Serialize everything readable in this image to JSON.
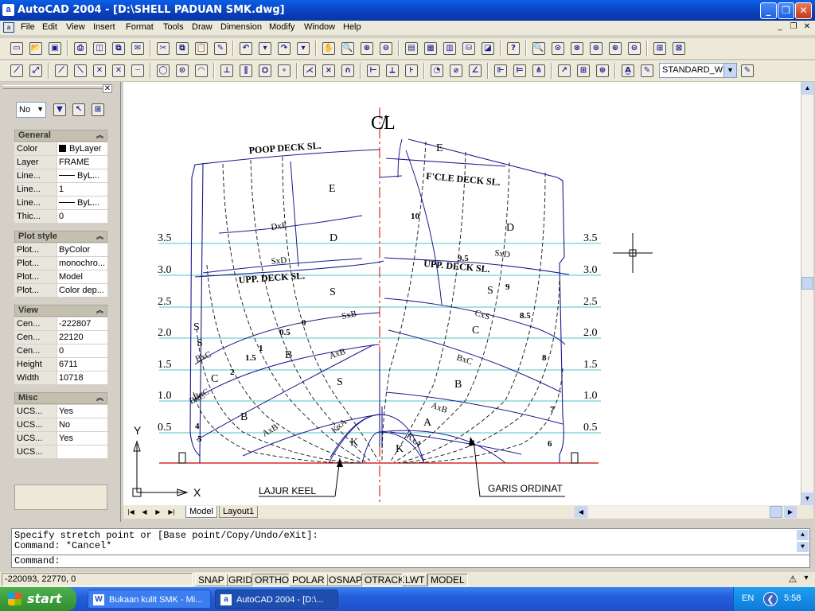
{
  "window": {
    "title": "AutoCAD 2004 - [D:\\SHELL PADUAN SMK.dwg]",
    "app_icon": "a",
    "controls": [
      "minimize-icon",
      "restore-icon",
      "close-icon"
    ]
  },
  "menu": {
    "items": [
      "File",
      "Edit",
      "View",
      "Insert",
      "Format",
      "Tools",
      "Draw",
      "Dimension",
      "Modify",
      "Window",
      "Help"
    ]
  },
  "toolbar": {
    "text_style": "STANDARD_W"
  },
  "palette": {
    "filter_value": "No",
    "sections": [
      {
        "title": "General",
        "rows": [
          {
            "key": "Color",
            "value": "ByLayer"
          },
          {
            "key": "Layer",
            "value": "FRAME"
          },
          {
            "key": "Line...",
            "value": "ByL..."
          },
          {
            "key": "Line...",
            "value": "1"
          },
          {
            "key": "Line...",
            "value": "ByL..."
          },
          {
            "key": "Thic...",
            "value": "0"
          }
        ]
      },
      {
        "title": "Plot style",
        "rows": [
          {
            "key": "Plot...",
            "value": "ByColor"
          },
          {
            "key": "Plot...",
            "value": "monochro..."
          },
          {
            "key": "Plot...",
            "value": "Model"
          },
          {
            "key": "Plot...",
            "value": "Color dep..."
          }
        ]
      },
      {
        "title": "View",
        "rows": [
          {
            "key": "Cen...",
            "value": "-222807"
          },
          {
            "key": "Cen...",
            "value": "22120"
          },
          {
            "key": "Cen...",
            "value": "0"
          },
          {
            "key": "Height",
            "value": "6711"
          },
          {
            "key": "Width",
            "value": "10718"
          }
        ]
      },
      {
        "title": "Misc",
        "rows": [
          {
            "key": "UCS...",
            "value": "Yes"
          },
          {
            "key": "UCS...",
            "value": "No"
          },
          {
            "key": "UCS...",
            "value": "Yes"
          },
          {
            "key": "UCS...",
            "value": ""
          }
        ]
      }
    ]
  },
  "drawing": {
    "centerline": "C̸L",
    "levels": [
      "3.5",
      "3.0",
      "2.5",
      "2.0",
      "1.5",
      "1.0",
      "0.5"
    ],
    "deck_labels": [
      "POOP DECK SL.",
      "F'CLE DECK SL.",
      "UPP. DECK SL.",
      "UPP. DECK SL."
    ],
    "strake_labels": [
      "E",
      "E",
      "D",
      "D",
      "S",
      "S",
      "S",
      "C",
      "C",
      "B",
      "B",
      "B",
      "A",
      "K",
      "K",
      "S",
      "S"
    ],
    "seam_labels": [
      "DxE",
      "SxD",
      "SxD",
      "SxB",
      "CxS",
      "BxC",
      "BxC",
      "AxB",
      "AxB",
      "BxC",
      "AxB",
      "KxA",
      "KxA",
      "BxC"
    ],
    "station_labels": [
      "10",
      "9.5",
      "9",
      "8.5",
      "8",
      "7",
      "6",
      "0",
      "0.5",
      "1",
      "1.5",
      "2",
      "4",
      "5"
    ],
    "callouts": [
      "LAJUR KEEL",
      "GARIS ORDINAT"
    ],
    "ucs_x": "X",
    "ucs_y": "Y"
  },
  "tabs": [
    "Model",
    "Layout1"
  ],
  "command": {
    "lines": [
      "Specify stretch point or [Base point/Copy/Undo/eXit]:",
      "Command: *Cancel*"
    ],
    "prompt": "Command:"
  },
  "status": {
    "coords": "-220093, 22770, 0",
    "toggles": [
      {
        "label": "SNAP",
        "on": false
      },
      {
        "label": "GRID",
        "on": false
      },
      {
        "label": "ORTHO",
        "on": true
      },
      {
        "label": "POLAR",
        "on": false
      },
      {
        "label": "OSNAP",
        "on": false
      },
      {
        "label": "OTRACK",
        "on": true
      },
      {
        "label": "LWT",
        "on": false
      },
      {
        "label": "MODEL",
        "on": true
      }
    ]
  },
  "taskbar": {
    "start_label": "start",
    "tasks": [
      "Bukaan kulit SMK - Mi...",
      "AutoCAD 2004 - [D:\\..."
    ],
    "language": "EN",
    "clock": "5:58"
  }
}
